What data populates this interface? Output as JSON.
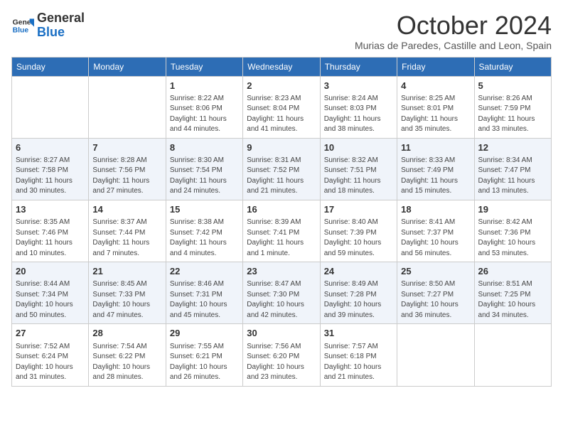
{
  "header": {
    "logo_general": "General",
    "logo_blue": "Blue",
    "month_title": "October 2024",
    "subtitle": "Murias de Paredes, Castille and Leon, Spain"
  },
  "weekdays": [
    "Sunday",
    "Monday",
    "Tuesday",
    "Wednesday",
    "Thursday",
    "Friday",
    "Saturday"
  ],
  "weeks": [
    [
      {
        "day": "",
        "sunrise": "",
        "sunset": "",
        "daylight": ""
      },
      {
        "day": "",
        "sunrise": "",
        "sunset": "",
        "daylight": ""
      },
      {
        "day": "1",
        "sunrise": "Sunrise: 8:22 AM",
        "sunset": "Sunset: 8:06 PM",
        "daylight": "Daylight: 11 hours and 44 minutes."
      },
      {
        "day": "2",
        "sunrise": "Sunrise: 8:23 AM",
        "sunset": "Sunset: 8:04 PM",
        "daylight": "Daylight: 11 hours and 41 minutes."
      },
      {
        "day": "3",
        "sunrise": "Sunrise: 8:24 AM",
        "sunset": "Sunset: 8:03 PM",
        "daylight": "Daylight: 11 hours and 38 minutes."
      },
      {
        "day": "4",
        "sunrise": "Sunrise: 8:25 AM",
        "sunset": "Sunset: 8:01 PM",
        "daylight": "Daylight: 11 hours and 35 minutes."
      },
      {
        "day": "5",
        "sunrise": "Sunrise: 8:26 AM",
        "sunset": "Sunset: 7:59 PM",
        "daylight": "Daylight: 11 hours and 33 minutes."
      }
    ],
    [
      {
        "day": "6",
        "sunrise": "Sunrise: 8:27 AM",
        "sunset": "Sunset: 7:58 PM",
        "daylight": "Daylight: 11 hours and 30 minutes."
      },
      {
        "day": "7",
        "sunrise": "Sunrise: 8:28 AM",
        "sunset": "Sunset: 7:56 PM",
        "daylight": "Daylight: 11 hours and 27 minutes."
      },
      {
        "day": "8",
        "sunrise": "Sunrise: 8:30 AM",
        "sunset": "Sunset: 7:54 PM",
        "daylight": "Daylight: 11 hours and 24 minutes."
      },
      {
        "day": "9",
        "sunrise": "Sunrise: 8:31 AM",
        "sunset": "Sunset: 7:52 PM",
        "daylight": "Daylight: 11 hours and 21 minutes."
      },
      {
        "day": "10",
        "sunrise": "Sunrise: 8:32 AM",
        "sunset": "Sunset: 7:51 PM",
        "daylight": "Daylight: 11 hours and 18 minutes."
      },
      {
        "day": "11",
        "sunrise": "Sunrise: 8:33 AM",
        "sunset": "Sunset: 7:49 PM",
        "daylight": "Daylight: 11 hours and 15 minutes."
      },
      {
        "day": "12",
        "sunrise": "Sunrise: 8:34 AM",
        "sunset": "Sunset: 7:47 PM",
        "daylight": "Daylight: 11 hours and 13 minutes."
      }
    ],
    [
      {
        "day": "13",
        "sunrise": "Sunrise: 8:35 AM",
        "sunset": "Sunset: 7:46 PM",
        "daylight": "Daylight: 11 hours and 10 minutes."
      },
      {
        "day": "14",
        "sunrise": "Sunrise: 8:37 AM",
        "sunset": "Sunset: 7:44 PM",
        "daylight": "Daylight: 11 hours and 7 minutes."
      },
      {
        "day": "15",
        "sunrise": "Sunrise: 8:38 AM",
        "sunset": "Sunset: 7:42 PM",
        "daylight": "Daylight: 11 hours and 4 minutes."
      },
      {
        "day": "16",
        "sunrise": "Sunrise: 8:39 AM",
        "sunset": "Sunset: 7:41 PM",
        "daylight": "Daylight: 11 hours and 1 minute."
      },
      {
        "day": "17",
        "sunrise": "Sunrise: 8:40 AM",
        "sunset": "Sunset: 7:39 PM",
        "daylight": "Daylight: 10 hours and 59 minutes."
      },
      {
        "day": "18",
        "sunrise": "Sunrise: 8:41 AM",
        "sunset": "Sunset: 7:37 PM",
        "daylight": "Daylight: 10 hours and 56 minutes."
      },
      {
        "day": "19",
        "sunrise": "Sunrise: 8:42 AM",
        "sunset": "Sunset: 7:36 PM",
        "daylight": "Daylight: 10 hours and 53 minutes."
      }
    ],
    [
      {
        "day": "20",
        "sunrise": "Sunrise: 8:44 AM",
        "sunset": "Sunset: 7:34 PM",
        "daylight": "Daylight: 10 hours and 50 minutes."
      },
      {
        "day": "21",
        "sunrise": "Sunrise: 8:45 AM",
        "sunset": "Sunset: 7:33 PM",
        "daylight": "Daylight: 10 hours and 47 minutes."
      },
      {
        "day": "22",
        "sunrise": "Sunrise: 8:46 AM",
        "sunset": "Sunset: 7:31 PM",
        "daylight": "Daylight: 10 hours and 45 minutes."
      },
      {
        "day": "23",
        "sunrise": "Sunrise: 8:47 AM",
        "sunset": "Sunset: 7:30 PM",
        "daylight": "Daylight: 10 hours and 42 minutes."
      },
      {
        "day": "24",
        "sunrise": "Sunrise: 8:49 AM",
        "sunset": "Sunset: 7:28 PM",
        "daylight": "Daylight: 10 hours and 39 minutes."
      },
      {
        "day": "25",
        "sunrise": "Sunrise: 8:50 AM",
        "sunset": "Sunset: 7:27 PM",
        "daylight": "Daylight: 10 hours and 36 minutes."
      },
      {
        "day": "26",
        "sunrise": "Sunrise: 8:51 AM",
        "sunset": "Sunset: 7:25 PM",
        "daylight": "Daylight: 10 hours and 34 minutes."
      }
    ],
    [
      {
        "day": "27",
        "sunrise": "Sunrise: 7:52 AM",
        "sunset": "Sunset: 6:24 PM",
        "daylight": "Daylight: 10 hours and 31 minutes."
      },
      {
        "day": "28",
        "sunrise": "Sunrise: 7:54 AM",
        "sunset": "Sunset: 6:22 PM",
        "daylight": "Daylight: 10 hours and 28 minutes."
      },
      {
        "day": "29",
        "sunrise": "Sunrise: 7:55 AM",
        "sunset": "Sunset: 6:21 PM",
        "daylight": "Daylight: 10 hours and 26 minutes."
      },
      {
        "day": "30",
        "sunrise": "Sunrise: 7:56 AM",
        "sunset": "Sunset: 6:20 PM",
        "daylight": "Daylight: 10 hours and 23 minutes."
      },
      {
        "day": "31",
        "sunrise": "Sunrise: 7:57 AM",
        "sunset": "Sunset: 6:18 PM",
        "daylight": "Daylight: 10 hours and 21 minutes."
      },
      {
        "day": "",
        "sunrise": "",
        "sunset": "",
        "daylight": ""
      },
      {
        "day": "",
        "sunrise": "",
        "sunset": "",
        "daylight": ""
      }
    ]
  ]
}
